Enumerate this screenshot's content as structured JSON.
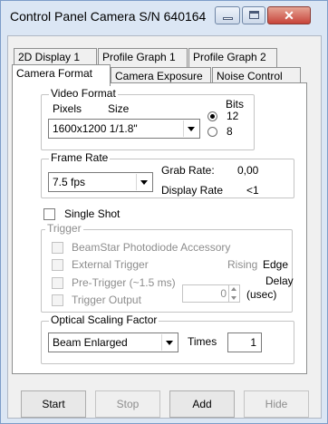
{
  "window": {
    "title": "Control Panel Camera S/N 640164"
  },
  "tabs": [
    {
      "label": "2D Display 1"
    },
    {
      "label": "Profile Graph 1"
    },
    {
      "label": "Profile Graph 2"
    },
    {
      "label": "Camera Format",
      "active": true
    },
    {
      "label": "Camera Exposure"
    },
    {
      "label": "Noise Control"
    }
  ],
  "video_format": {
    "legend": "Video Format",
    "pixels_label": "Pixels",
    "size_label": "Size",
    "selected": "1600x1200  1/1.8\"",
    "bits_label": "Bits",
    "bits_options": [
      "12",
      "8"
    ],
    "bits_selected": "12"
  },
  "frame_rate": {
    "legend": "Frame Rate",
    "selected": "7.5 fps",
    "grab_rate_label": "Grab Rate:",
    "grab_rate_value": "0,00",
    "display_rate_label": "Display Rate",
    "display_rate_value": "<1"
  },
  "single_shot": {
    "label": "Single Shot",
    "checked": false
  },
  "trigger": {
    "legend": "Trigger",
    "beamstar_label": "BeamStar Photodiode Accessory",
    "external_label": "External Trigger",
    "rising_edge_label": "Rising Edge",
    "pretrigger_label": "Pre-Trigger (~1.5 ms)",
    "delay_label": "Delay",
    "delay_unit": "(usec)",
    "delay_value": "0",
    "output_label": "Trigger Output"
  },
  "optical_scaling": {
    "legend": "Optical Scaling Factor",
    "selected": "Beam Enlarged",
    "times_label": "Times",
    "times_value": "1"
  },
  "buttons": {
    "start": "Start",
    "stop": "Stop",
    "add": "Add",
    "hide": "Hide"
  },
  "colors": {
    "frame": "#dbe6f4",
    "close_button": "#c7443a",
    "disabled_text": "#8d8d8d"
  }
}
